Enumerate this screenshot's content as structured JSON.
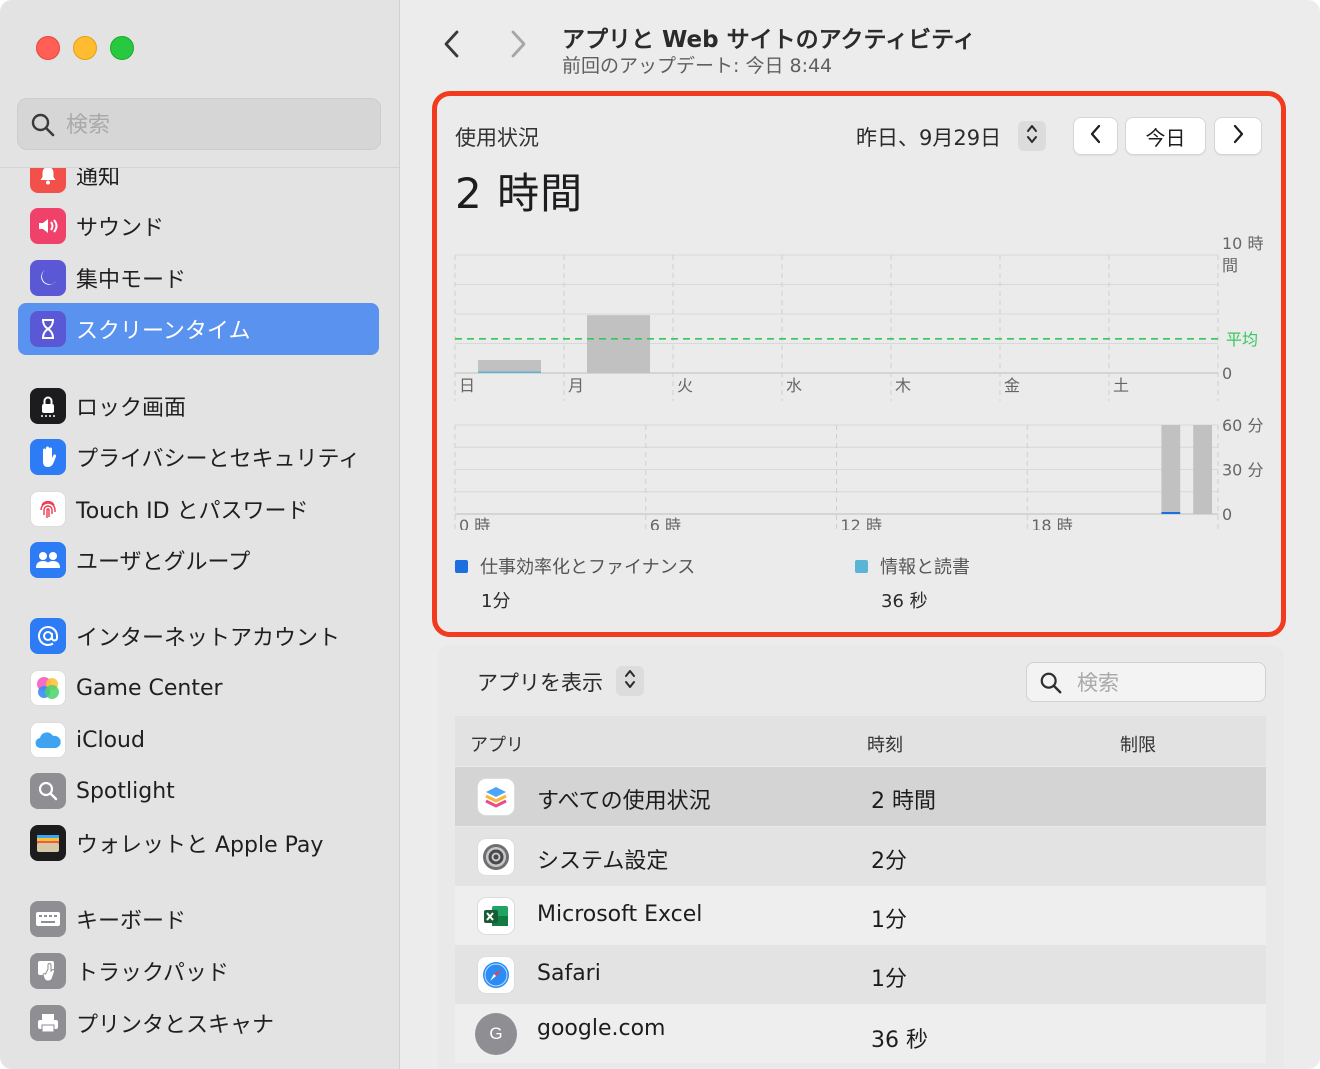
{
  "sidebar": {
    "search_placeholder": "検索",
    "items": [
      {
        "label": "通知",
        "icon": "bell-icon",
        "color": "#f2504a"
      },
      {
        "label": "サウンド",
        "icon": "speaker-icon",
        "color": "#f0416a"
      },
      {
        "label": "集中モード",
        "icon": "moon-icon",
        "color": "#5b58d6"
      },
      {
        "label": "スクリーンタイム",
        "icon": "hourglass-icon",
        "color": "#5b58d6"
      },
      {
        "label": "ロック画面",
        "icon": "lock-icon",
        "color": "#1c1c1e"
      },
      {
        "label": "プライバシーとセキュリティ",
        "icon": "hand-icon",
        "color": "#2d7cf6"
      },
      {
        "label": "Touch ID とパスワード",
        "icon": "fingerprint-icon",
        "color": "#ffffff"
      },
      {
        "label": "ユーザとグループ",
        "icon": "users-icon",
        "color": "#2d7cf6"
      },
      {
        "label": "インターネットアカウント",
        "icon": "at-icon",
        "color": "#2d7cf6"
      },
      {
        "label": "Game Center",
        "icon": "game-center-icon",
        "color": "#ffffff"
      },
      {
        "label": "iCloud",
        "icon": "cloud-icon",
        "color": "#ffffff"
      },
      {
        "label": "Spotlight",
        "icon": "spotlight-icon",
        "color": "#8e8e93"
      },
      {
        "label": "ウォレットと Apple Pay",
        "icon": "wallet-icon",
        "color": "#1c1c1e"
      },
      {
        "label": "キーボード",
        "icon": "keyboard-icon",
        "color": "#8e8e93"
      },
      {
        "label": "トラックパッド",
        "icon": "trackpad-icon",
        "color": "#8e8e93"
      },
      {
        "label": "プリンタとスキャナ",
        "icon": "printer-icon",
        "color": "#8e8e93"
      }
    ]
  },
  "header": {
    "title": "アプリと Web サイトのアクティビティ",
    "subtitle": "前回のアップデート: 今日 8:44"
  },
  "usage": {
    "label": "使用状況",
    "total": "2 時間",
    "date": "昨日、9月29日",
    "today_button": "今日"
  },
  "chart_data": [
    {
      "type": "bar",
      "categories": [
        "日",
        "月",
        "火",
        "水",
        "木",
        "金",
        "土"
      ],
      "values": [
        1.1,
        4.9,
        0,
        0,
        0,
        0,
        0
      ],
      "ylim": [
        0,
        10
      ],
      "y_ticks": [
        "10 時間",
        "0"
      ],
      "average": 2.9,
      "average_label": "平均",
      "average_color": "#34c759",
      "bar_color": "#c1c1c1"
    },
    {
      "type": "bar",
      "x_ticks": [
        "0 時",
        "6 時",
        "12 時",
        "18 時"
      ],
      "bars": [
        {
          "hour": 22,
          "minutes": 60
        },
        {
          "hour": 23,
          "minutes": 60
        }
      ],
      "ylim": [
        0,
        60
      ],
      "y_ticks": [
        "60 分",
        "30 分",
        "0"
      ],
      "bar_color": "#c1c1c1"
    }
  ],
  "legend": [
    {
      "name": "仕事効率化とファイナンス",
      "value": "1分",
      "color": "#1d6fe0"
    },
    {
      "name": "情報と読書",
      "value": "36 秒",
      "color": "#5ab4d6"
    }
  ],
  "apps": {
    "toggle_label": "アプリを表示",
    "search_placeholder": "検索",
    "columns": {
      "app": "アプリ",
      "time": "時刻",
      "limit": "制限"
    },
    "rows": [
      {
        "name": "すべての使用状況",
        "time": "2 時間",
        "icon": "stack-icon"
      },
      {
        "name": "システム設定",
        "time": "2分",
        "icon": "gear-icon"
      },
      {
        "name": "Microsoft Excel",
        "time": "1分",
        "icon": "excel-icon"
      },
      {
        "name": "Safari",
        "time": "1分",
        "icon": "compass-icon"
      },
      {
        "name": "google.com",
        "time": "36 秒",
        "icon": "google-icon",
        "icon_letter": "G"
      }
    ]
  }
}
